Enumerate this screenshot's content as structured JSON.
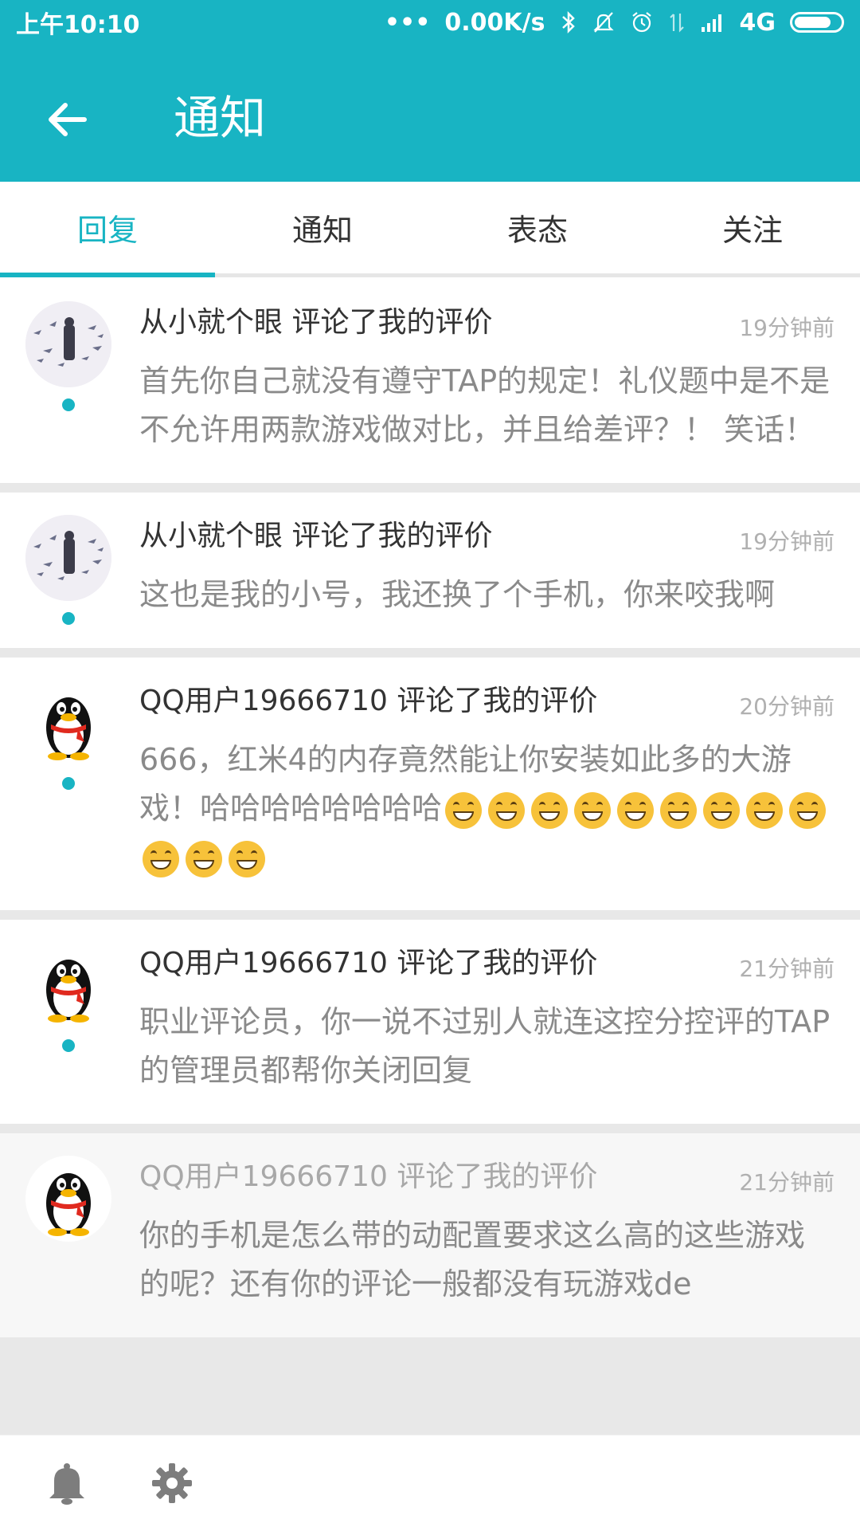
{
  "status_bar": {
    "time": "上午10:10",
    "net_speed": "0.00K/s",
    "network": "4G"
  },
  "header": {
    "title": "通知"
  },
  "tabs": [
    {
      "label": "回复",
      "active": true
    },
    {
      "label": "通知",
      "active": false
    },
    {
      "label": "表态",
      "active": false
    },
    {
      "label": "关注",
      "active": false
    }
  ],
  "notifications": [
    {
      "title": "从小就个眼 评论了我的评价",
      "time": "19分钟前",
      "body": "首先你自己就没有遵守TAP的规定！礼仪题中是不是不允许用两款游戏做对比，并且给差评？！ 笑话！",
      "avatar": "birds-avatar",
      "unread": true
    },
    {
      "title": "从小就个眼 评论了我的评价",
      "time": "19分钟前",
      "body": "这也是我的小号，我还换了个手机，你来咬我啊",
      "avatar": "birds-avatar",
      "unread": true
    },
    {
      "title": "QQ用户19666710 评论了我的评价",
      "time": "20分钟前",
      "body": "666，红米4的内存竟然能让你安装如此多的大游戏！哈哈哈哈哈哈哈哈",
      "emoji_count": 12,
      "avatar": "qq-penguin-avatar",
      "unread": true
    },
    {
      "title": "QQ用户19666710 评论了我的评价",
      "time": "21分钟前",
      "body": "职业评论员，你一说不过别人就连这控分控评的TAP的管理员都帮你关闭回复",
      "avatar": "qq-penguin-avatar",
      "unread": true
    },
    {
      "title": "QQ用户19666710 评论了我的评价",
      "time": "21分钟前",
      "body": "你的手机是怎么带的动配置要求这么高的这些游戏的呢？还有你的评论一般都没有玩游戏de",
      "avatar": "qq-penguin-avatar",
      "unread": false
    }
  ],
  "colors": {
    "accent": "#18b4c3",
    "title_text": "#333333",
    "body_text": "#8a8a8a",
    "time_text": "#b0b0b0"
  },
  "icons": {
    "back": "arrow-left-icon",
    "bottom_left": "bell-icon",
    "bottom_right": "gear-icon"
  }
}
